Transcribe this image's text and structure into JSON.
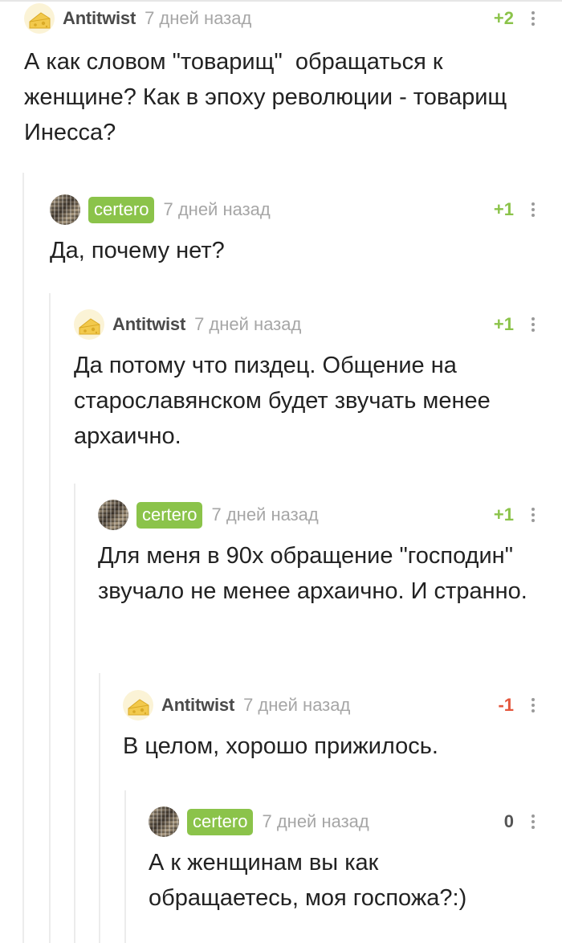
{
  "comments": [
    {
      "author": "Antitwist",
      "time": "7 дней назад",
      "rating": "+2",
      "text": "А как словом \"товарищ\"  обращаться к женщине? Как в эпоху революции - товарищ Инесса?"
    },
    {
      "author": "certero",
      "time": "7 дней назад",
      "rating": "+1",
      "text": "Да, почему нет?"
    },
    {
      "author": "Antitwist",
      "time": "7 дней назад",
      "rating": "+1",
      "text": "Да потому что пиздец. Общение на старославянском будет звучать менее архаично."
    },
    {
      "author": "certero",
      "time": "7 дней назад",
      "rating": "+1",
      "text": "Для меня в 90х обращение \"господин\" звучало не менее архаично. И странно."
    },
    {
      "author": "Antitwist",
      "time": "7 дней назад",
      "rating": "-1",
      "text": "В целом, хорошо прижилось."
    },
    {
      "author": "certero",
      "time": "7 дней назад",
      "rating": "0",
      "text": "А к женщинам вы как обращаетесь, моя госпожа?:)"
    }
  ],
  "colors": {
    "tag_green": "#8bc34a",
    "rating_positive": "#8bc34a",
    "rating_negative": "#e4573d",
    "rating_zero": "#555555",
    "time_gray": "#a6a6a6"
  },
  "icons": {
    "more": "vertical-dots-icon",
    "antitwist_avatar": "cheese-avatar",
    "certero_avatar": "mosaic-avatar"
  }
}
